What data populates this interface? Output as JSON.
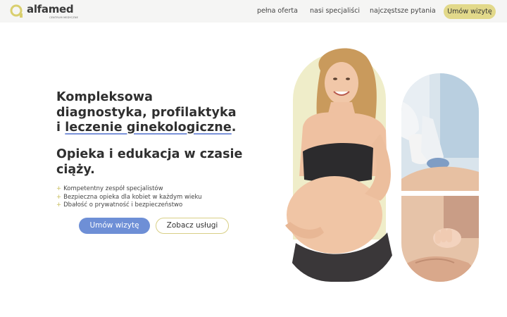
{
  "brand": {
    "name": "alfamed",
    "tagline": "CENTRUM MEDYCZNE",
    "accent": "#e2d98a",
    "primary": "#6e8fd6"
  },
  "nav": {
    "items": [
      "pełna oferta",
      "nasi specjaliści",
      "najczęstsze pytania"
    ],
    "cta_label": "Umów wizytę"
  },
  "hero": {
    "heading_line1": "Kompleksowa",
    "heading_line2": "diagnostyka, profilaktyka",
    "heading_line3_prefix": "i ",
    "heading_line3_highlight": "leczenie ginekologiczne",
    "heading_line3_suffix": ".",
    "subheading": "Opieka i edukacja w czasie ciąży.",
    "bullets": [
      "Kompetentny zespół specjalistów",
      "Bezpieczna opieka dla kobiet w każdym wieku",
      "Dbałość o prywatność i bezpieczeństwo"
    ],
    "bullet_marker": "+",
    "primary_button": "Umów wizytę",
    "secondary_button": "Zobacz usługi"
  },
  "images": {
    "main": "pregnant-woman-photo",
    "top": "ultrasound-exam-photo",
    "bottom": "baby-hand-photo"
  }
}
